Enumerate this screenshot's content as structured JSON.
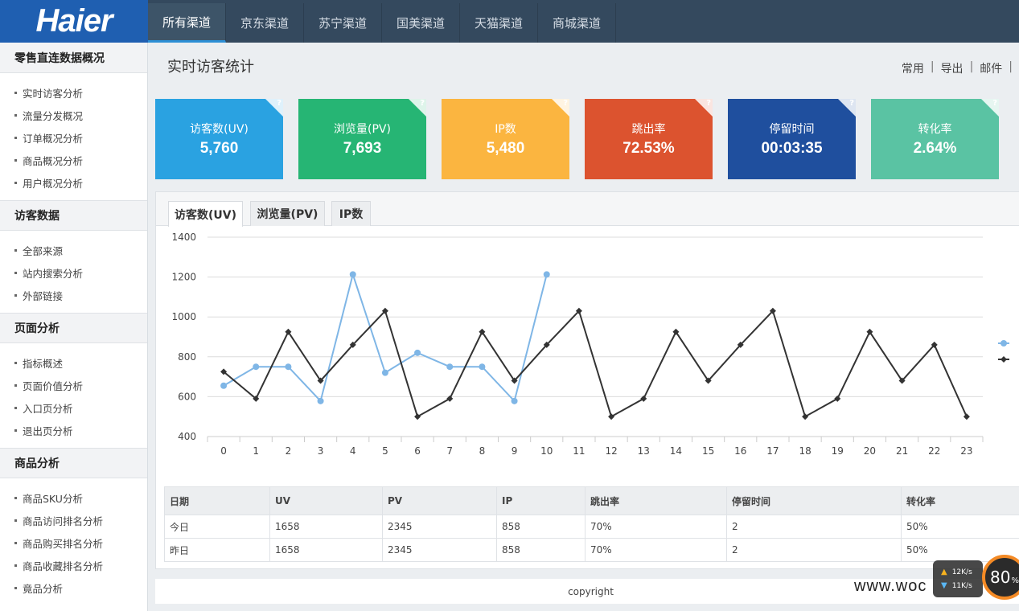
{
  "brand": {
    "logo": "Haier"
  },
  "nav": {
    "items": [
      {
        "label": "所有渠道",
        "active": true
      },
      {
        "label": "京东渠道"
      },
      {
        "label": "苏宁渠道"
      },
      {
        "label": "国美渠道"
      },
      {
        "label": "天猫渠道"
      },
      {
        "label": "商城渠道"
      }
    ]
  },
  "sidebar": {
    "groups": [
      {
        "title": "零售直连数据概况",
        "items": [
          "实时访客分析",
          "流量分发概况",
          "订单概况分析",
          "商品概况分析",
          "用户概况分析"
        ]
      },
      {
        "title": "访客数据",
        "items": [
          "全部来源",
          "站内搜索分析",
          "外部链接"
        ]
      },
      {
        "title": "页面分析",
        "items": [
          "指标概述",
          "页面价值分析",
          "入口页分析",
          "退出页分析"
        ]
      },
      {
        "title": "商品分析",
        "items": [
          "商品SKU分析",
          "商品访问排名分析",
          "商品购买排名分析",
          "商品收藏排名分析",
          "竟品分析"
        ]
      }
    ]
  },
  "page": {
    "title": "实时访客统计",
    "toolbar": {
      "common": "常用",
      "export": "导出",
      "mail": "邮件"
    }
  },
  "cards": [
    {
      "label": "访客数(UV)",
      "value": "5,760",
      "color": "#2aa2e1",
      "help": "?"
    },
    {
      "label": "浏览量(PV)",
      "value": "7,693",
      "color": "#26b574",
      "help": "?"
    },
    {
      "label": "IP数",
      "value": "5,480",
      "color": "#fbb540",
      "help": "?"
    },
    {
      "label": "跳出率",
      "value": "72.53%",
      "color": "#dc532f",
      "help": "?"
    },
    {
      "label": "停留时间",
      "value": "00:03:35",
      "color": "#1f4f9e",
      "help": "?"
    },
    {
      "label": "转化率",
      "value": "2.64%",
      "color": "#5ac3a3",
      "help": "?"
    }
  ],
  "tabs": [
    {
      "label": "访客数(UV)",
      "active": true
    },
    {
      "label": "浏览量(PV)"
    },
    {
      "label": "IP数"
    }
  ],
  "chart_data": {
    "type": "line",
    "x": [
      0,
      1,
      2,
      3,
      4,
      5,
      6,
      7,
      8,
      9,
      10,
      11,
      12,
      13,
      14,
      15,
      16,
      17,
      18,
      19,
      20,
      21,
      22,
      23
    ],
    "ylim": [
      400,
      1400
    ],
    "yticks": [
      400,
      600,
      800,
      1000,
      1200,
      1400
    ],
    "grid": true,
    "legend": "right",
    "series": [
      {
        "color": "#7fb6e6",
        "marker": "circle",
        "values": [
          655,
          750,
          750,
          578,
          1213,
          720,
          820,
          750,
          750,
          578,
          1213
        ]
      },
      {
        "color": "#333333",
        "marker": "diamond",
        "values": [
          725,
          590,
          925,
          680,
          860,
          1030,
          500,
          590,
          925,
          680,
          860,
          1030,
          500,
          590,
          925,
          680,
          860,
          1030,
          500,
          590,
          925,
          680,
          860,
          500
        ]
      }
    ]
  },
  "table": {
    "headers": [
      "日期",
      "UV",
      "PV",
      "IP",
      "跳出率",
      "停留时间",
      "转化率"
    ],
    "rows": [
      [
        "今日",
        "1658",
        "2345",
        "858",
        "70%",
        "2",
        "50%"
      ],
      [
        "昨日",
        "1658",
        "2345",
        "858",
        "70%",
        "2",
        "50%"
      ]
    ]
  },
  "footer": {
    "text": "copyright"
  },
  "overlay": {
    "watermark": "www.woc",
    "upload_speed": "12K/s",
    "download_speed": "11K/s",
    "gauge_value": "80",
    "gauge_unit": "%"
  }
}
